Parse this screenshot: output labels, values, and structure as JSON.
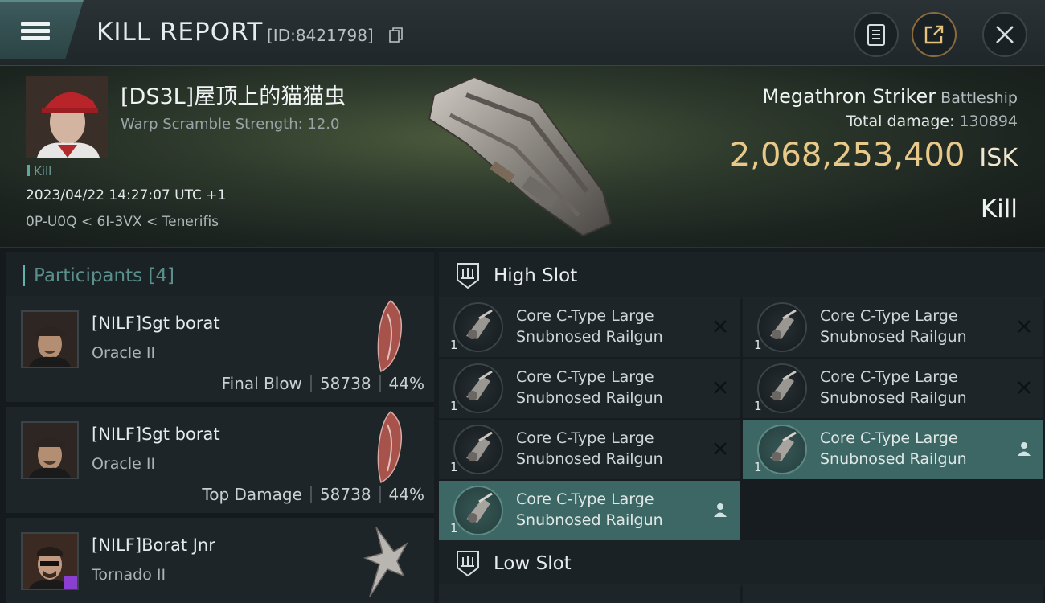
{
  "header": {
    "title": "KILL REPORT",
    "kill_id": "[ID:8421798]",
    "buttons": [
      "clipboard-icon",
      "share-icon",
      "close-icon"
    ]
  },
  "victim": {
    "name": "[DS3L]屋顶上的猫猫虫",
    "warp_scramble": "Warp Scramble Strength: 12.0",
    "tag": "Kill",
    "datetime": "2023/04/22 14:27:07 UTC +1",
    "location": "0P-U0Q < 6I-3VX < Tenerifis",
    "ship_name": "Megathron Striker",
    "ship_class": "Battleship",
    "total_damage_label": "Total damage:",
    "total_damage": "130894",
    "isk_value": "2,068,253,400",
    "isk_unit": "ISK",
    "result": "Kill"
  },
  "participants": {
    "header": "Participants [4]",
    "items": [
      {
        "name": "[NILF]Sgt borat",
        "ship": "Oracle II",
        "label": "Final Blow",
        "damage": "58738",
        "percent": "44%"
      },
      {
        "name": "[NILF]Sgt borat",
        "ship": "Oracle II",
        "label": "Top Damage",
        "damage": "58738",
        "percent": "44%"
      },
      {
        "name": "[NILF]Borat Jnr",
        "ship": "Tornado II",
        "label": "",
        "damage": "",
        "percent": ""
      }
    ]
  },
  "slots": {
    "high": {
      "label": "High Slot",
      "modules": [
        {
          "qty": "1",
          "line1": "Core C-Type Large",
          "line2": "Snubnosed Railgun",
          "state": "destroyed"
        },
        {
          "qty": "1",
          "line1": "Core C-Type Large",
          "line2": "Snubnosed Railgun",
          "state": "destroyed"
        },
        {
          "qty": "1",
          "line1": "Core C-Type Large",
          "line2": "Snubnosed Railgun",
          "state": "destroyed"
        },
        {
          "qty": "1",
          "line1": "Core C-Type Large",
          "line2": "Snubnosed Railgun",
          "state": "destroyed"
        },
        {
          "qty": "1",
          "line1": "Core C-Type Large",
          "line2": "Snubnosed Railgun",
          "state": "destroyed"
        },
        {
          "qty": "1",
          "line1": "Core C-Type Large",
          "line2": "Snubnosed Railgun",
          "state": "dropped"
        },
        {
          "qty": "1",
          "line1": "Core C-Type Large",
          "line2": "Snubnosed Railgun",
          "state": "dropped"
        }
      ]
    },
    "low": {
      "label": "Low Slot"
    }
  },
  "colors": {
    "accent": "#5fb3ad",
    "isk": "#e9c98a",
    "fitted": "#3d6764"
  }
}
